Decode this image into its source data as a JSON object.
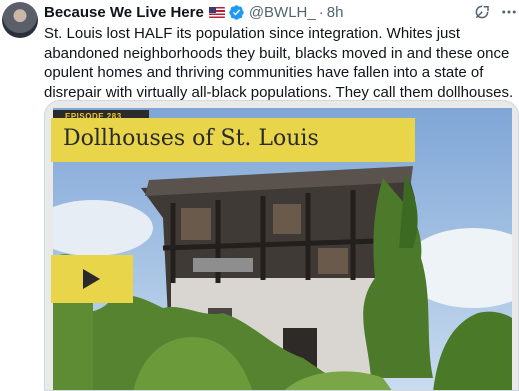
{
  "tweet": {
    "author_name": "Because We Live Here",
    "handle": "@BWLH_",
    "separator": "·",
    "time": "8h",
    "text": "St. Louis lost HALF its population since integration. Whites just abandoned neighborhoods they built, blacks moved in and these once opulent homes and thriving communities have fallen into a state of disrepair with virtually all-black populations. They call them dollhouses."
  },
  "media": {
    "episode_label": "EPISODE 283",
    "title": "Dollhouses of St. Louis"
  },
  "icons": {
    "flag": "us-flag-icon",
    "verified": "verified-badge-icon",
    "grok": "grok-icon",
    "more": "more-options-icon",
    "play": "play-icon"
  },
  "colors": {
    "verified": "#1d9bf0",
    "banner_yellow": "#e8d54a",
    "secondary_text": "#536471"
  }
}
